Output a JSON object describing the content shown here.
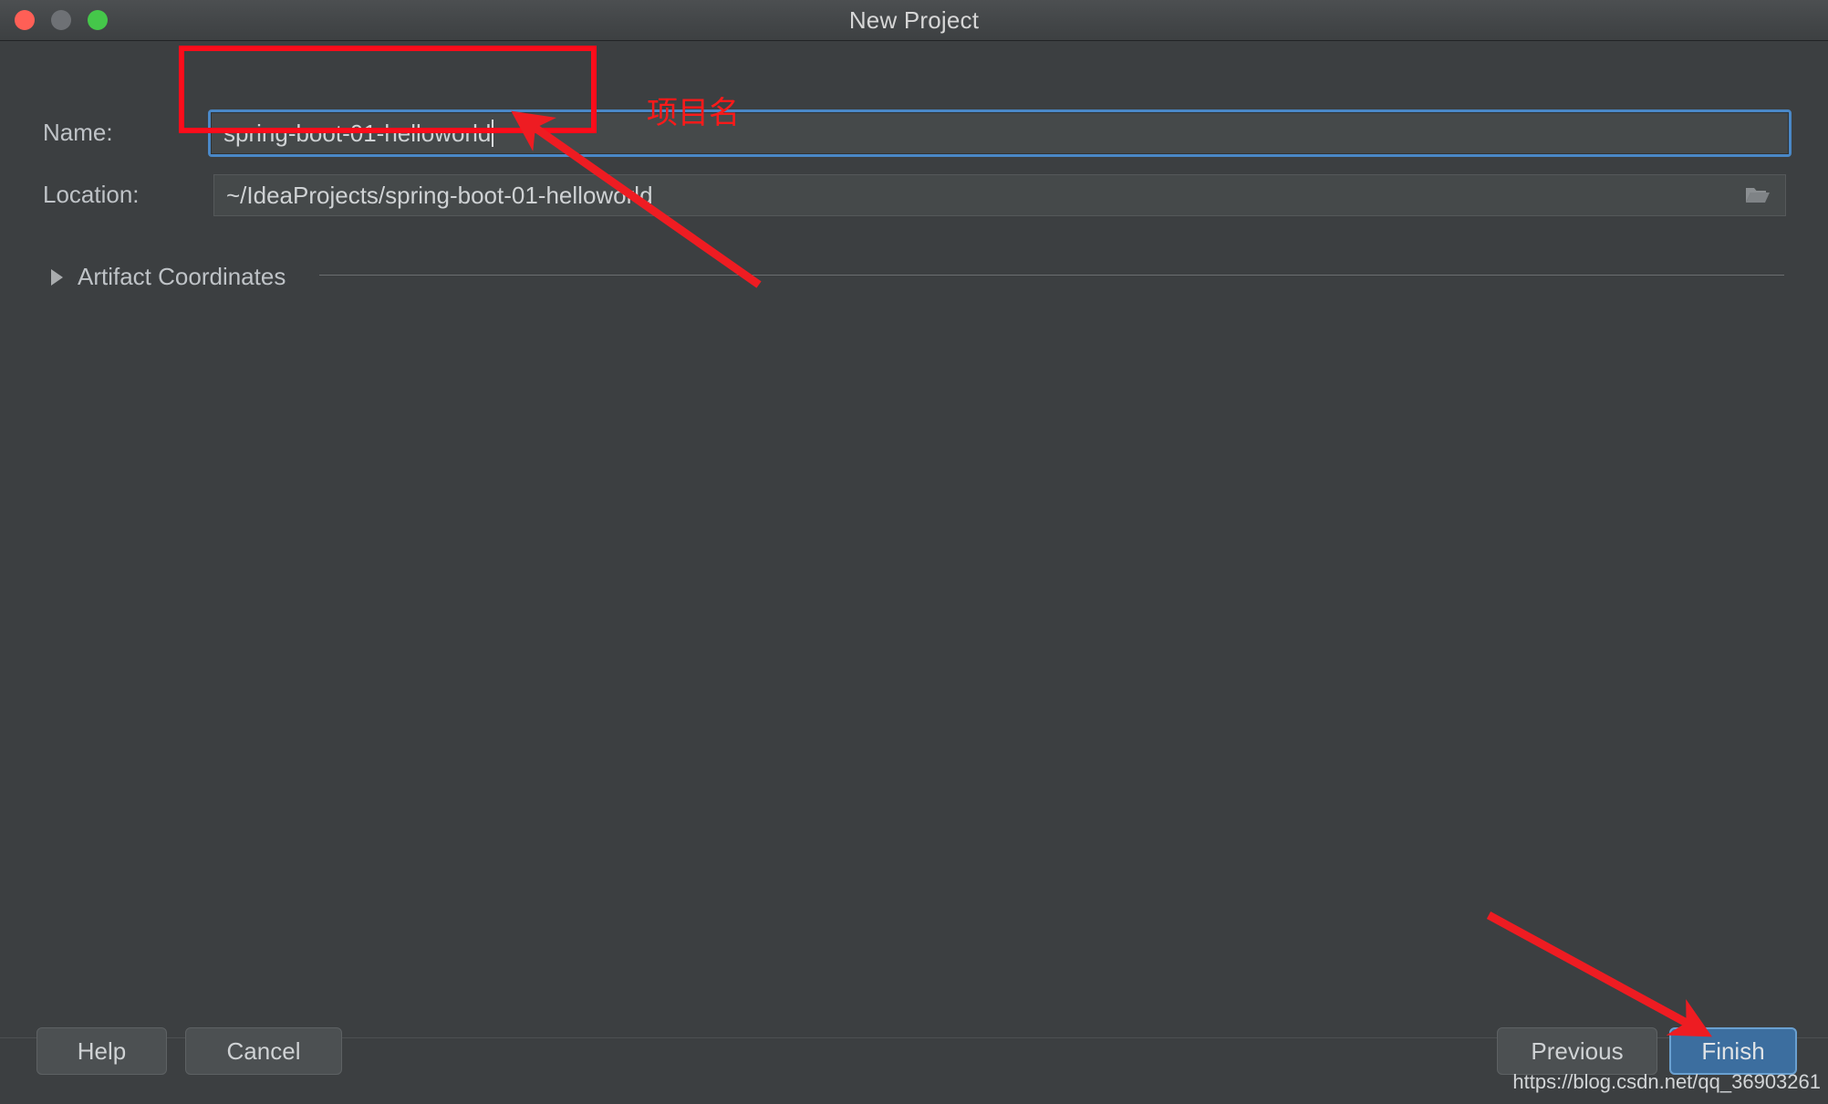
{
  "window": {
    "title": "New Project",
    "controls": [
      {
        "name": "close",
        "color": "#ff5f56"
      },
      {
        "name": "minimize",
        "color": "#6e7175"
      },
      {
        "name": "maximize",
        "color": "#45c74a"
      }
    ]
  },
  "form": {
    "name_label": "Name:",
    "name_value": "spring-boot-01-helloworld",
    "location_label": "Location:",
    "location_value": "~/IdeaProjects/spring-boot-01-helloworld",
    "browse_icon": "folder-icon"
  },
  "section": {
    "artifact_coordinates_label": "Artifact Coordinates",
    "expander_icon": "triangle-right-icon",
    "expanded": false
  },
  "buttons": {
    "help": "Help",
    "cancel": "Cancel",
    "previous": "Previous",
    "finish": "Finish"
  },
  "annotations": {
    "project_name_note": "项目名",
    "highlight_color": "#fc0d1b",
    "arrow_color": "#ee1c22"
  },
  "watermark": {
    "text": "https://blog.csdn.net/qq_36903261"
  },
  "colors": {
    "dialog_background": "#3c3f41",
    "titlebar_background": "#434648",
    "field_background": "#45494a",
    "focus_ring": "#4a88c7",
    "primary_button": "#3c6e9f",
    "text": "#bfc3c7"
  }
}
